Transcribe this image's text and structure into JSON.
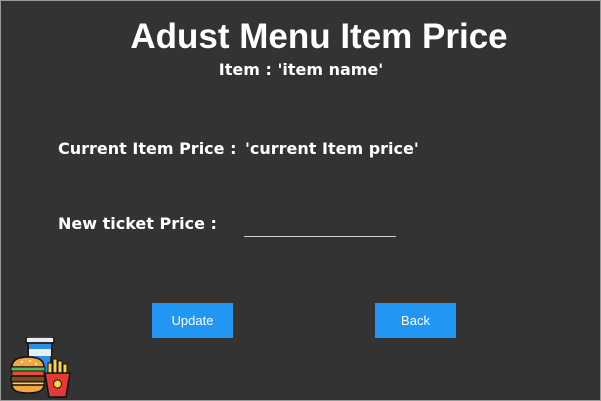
{
  "header": {
    "title": "Adust Menu Item Price",
    "subtitle": "Item : 'item name'"
  },
  "form": {
    "current_price_label": "Current Item Price :",
    "current_price_value": "'current Item price'",
    "new_price_label": "New ticket Price :",
    "new_price_value": ""
  },
  "buttons": {
    "update_label": "Update",
    "back_label": "Back"
  },
  "icons": {
    "logo": "fast-food-icon"
  },
  "colors": {
    "background": "#333333",
    "button": "#2196f3",
    "text": "#ffffff"
  }
}
